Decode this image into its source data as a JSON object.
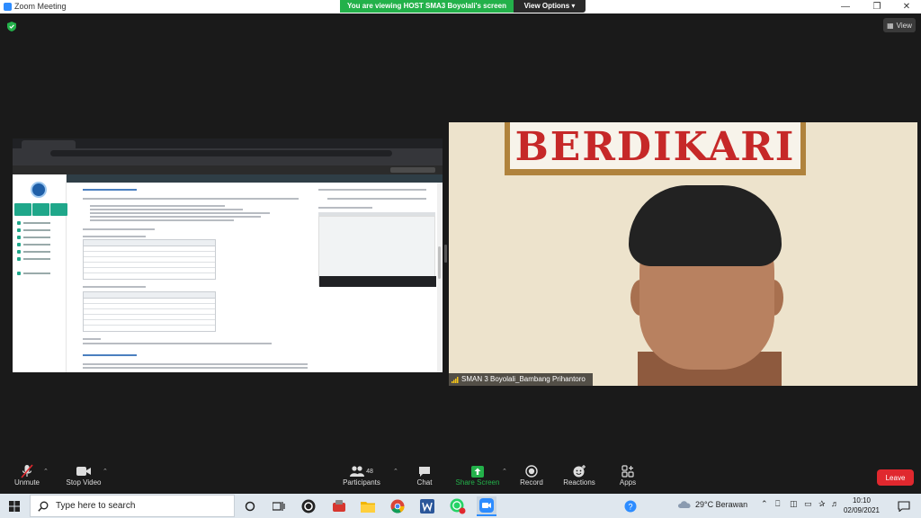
{
  "window": {
    "title": "Zoom Meeting"
  },
  "share_banner": {
    "text": "You are viewing HOST SMA3 Boyolali's screen",
    "view_options": "View Options"
  },
  "view_button": {
    "label": "View"
  },
  "participant": {
    "name": "SMAN 3 Boyolali_Bambang Prihantoro",
    "banner_text": "BERDIKARI"
  },
  "toolbar": {
    "unmute": "Unmute",
    "stop_video": "Stop Video",
    "participants": "Participants",
    "participants_count": "48",
    "chat": "Chat",
    "share_screen": "Share Screen",
    "record": "Record",
    "reactions": "Reactions",
    "apps": "Apps",
    "leave": "Leave"
  },
  "taskbar": {
    "search_placeholder": "Type here to search",
    "weather": "29°C  Berawan",
    "time": "10:10",
    "date": "02/09/2021"
  },
  "colors": {
    "zoom_blue": "#2d8cff",
    "share_green": "#23b14a",
    "leave_red": "#e0282e",
    "banner_red": "#c62828"
  }
}
